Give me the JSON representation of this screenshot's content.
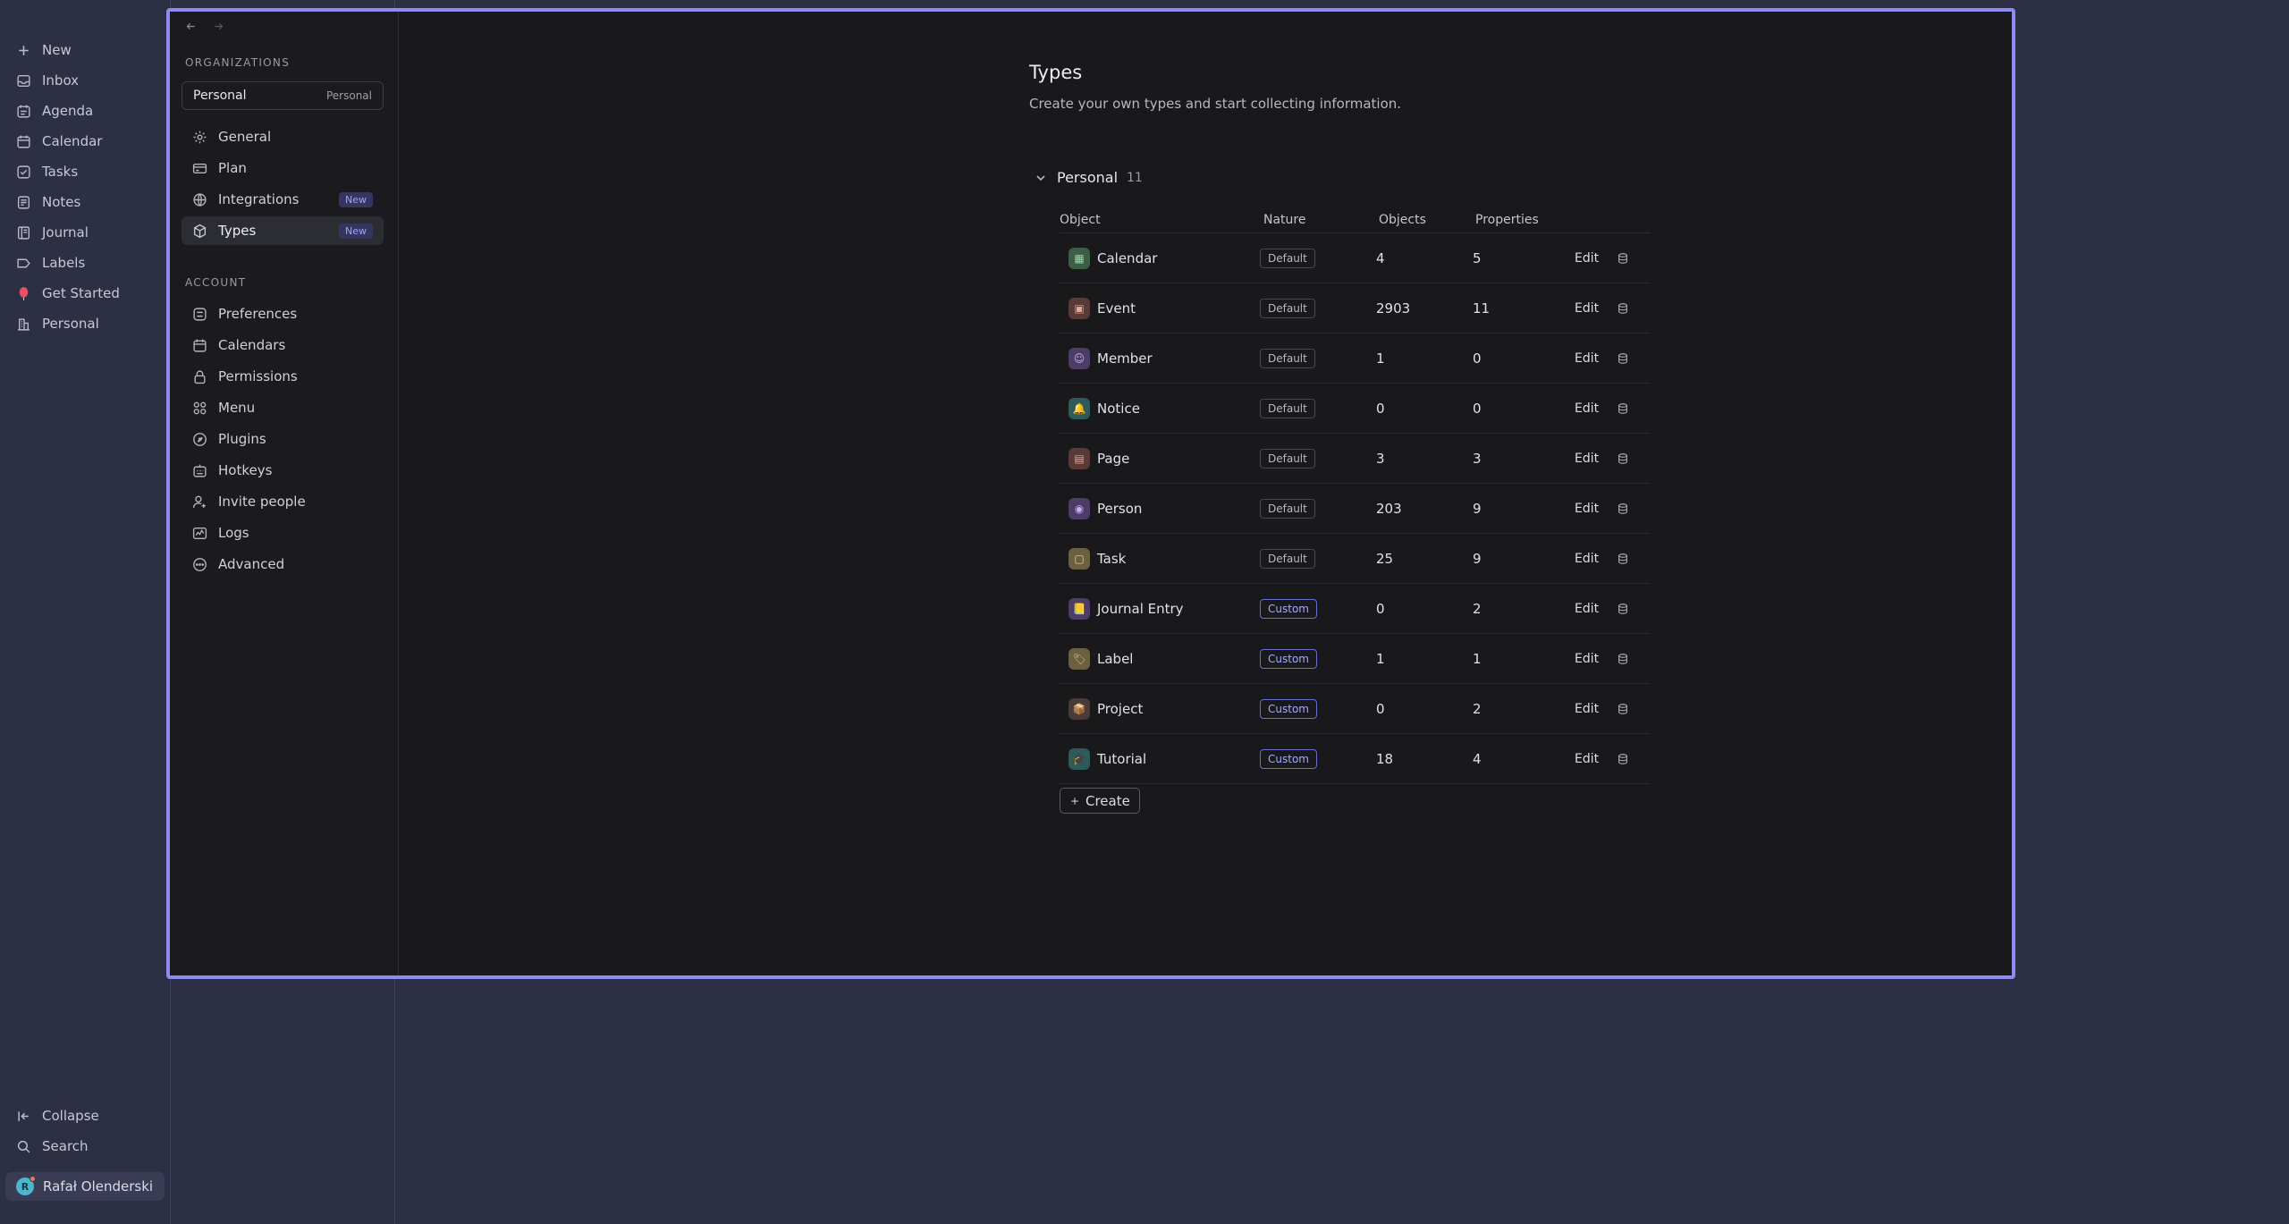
{
  "sidebar": {
    "items": [
      {
        "label": "New",
        "icon": "plus-icon"
      },
      {
        "label": "Inbox",
        "icon": "inbox-icon"
      },
      {
        "label": "Agenda",
        "icon": "agenda-icon"
      },
      {
        "label": "Calendar",
        "icon": "calendar-icon"
      },
      {
        "label": "Tasks",
        "icon": "check-square-icon"
      },
      {
        "label": "Notes",
        "icon": "notes-icon"
      },
      {
        "label": "Journal",
        "icon": "journal-icon"
      },
      {
        "label": "Labels",
        "icon": "tag-icon"
      },
      {
        "label": "Get Started",
        "icon": "balloon-icon"
      },
      {
        "label": "Personal",
        "icon": "building-icon"
      }
    ],
    "bottom": {
      "collapse_label": "Collapse",
      "search_label": "Search",
      "user_name": "Rafał Olenderski",
      "user_initial": "R"
    }
  },
  "settings": {
    "organizations_title": "ORGANIZATIONS",
    "org_name": "Personal",
    "org_tag": "Personal",
    "org_items": [
      {
        "label": "General",
        "icon": "gear-icon",
        "badge": ""
      },
      {
        "label": "Plan",
        "icon": "card-icon",
        "badge": ""
      },
      {
        "label": "Integrations",
        "icon": "globe-icon",
        "badge": "New"
      },
      {
        "label": "Types",
        "icon": "cube-icon",
        "badge": "New"
      }
    ],
    "account_title": "ACCOUNT",
    "account_items": [
      {
        "label": "Preferences",
        "icon": "preferences-icon"
      },
      {
        "label": "Calendars",
        "icon": "calendar-icon"
      },
      {
        "label": "Permissions",
        "icon": "lock-icon"
      },
      {
        "label": "Menu",
        "icon": "grid-icon"
      },
      {
        "label": "Plugins",
        "icon": "plugin-icon"
      },
      {
        "label": "Hotkeys",
        "icon": "keyboard-icon"
      },
      {
        "label": "Invite people",
        "icon": "user-plus-icon"
      },
      {
        "label": "Logs",
        "icon": "logs-icon"
      },
      {
        "label": "Advanced",
        "icon": "more-icon"
      }
    ]
  },
  "main": {
    "title": "Types",
    "subtitle": "Create your own types and start collecting information.",
    "group": {
      "name": "Personal",
      "count": "11"
    },
    "columns": {
      "object": "Object",
      "nature": "Nature",
      "objects": "Objects",
      "properties": "Properties"
    },
    "edit_label": "Edit",
    "create_label": "Create",
    "rows": [
      {
        "name": "Calendar",
        "nature": "Default",
        "objects": "4",
        "properties": "5",
        "icon_bg": "#3d5e45",
        "icon_fg": "#9cd8a6",
        "glyph": "▦"
      },
      {
        "name": "Event",
        "nature": "Default",
        "objects": "2903",
        "properties": "11",
        "icon_bg": "#5a3a36",
        "icon_fg": "#e0a79b",
        "glyph": "▣"
      },
      {
        "name": "Member",
        "nature": "Default",
        "objects": "1",
        "properties": "0",
        "icon_bg": "#4d3d66",
        "icon_fg": "#c4b0ee",
        "glyph": "☺"
      },
      {
        "name": "Notice",
        "nature": "Default",
        "objects": "0",
        "properties": "0",
        "icon_bg": "#2f5a5c",
        "icon_fg": "#f2c94c",
        "glyph": "🔔"
      },
      {
        "name": "Page",
        "nature": "Default",
        "objects": "3",
        "properties": "3",
        "icon_bg": "#5a3a36",
        "icon_fg": "#e0a79b",
        "glyph": "▤"
      },
      {
        "name": "Person",
        "nature": "Default",
        "objects": "203",
        "properties": "9",
        "icon_bg": "#4d3d66",
        "icon_fg": "#c4b0ee",
        "glyph": "◉"
      },
      {
        "name": "Task",
        "nature": "Default",
        "objects": "25",
        "properties": "9",
        "icon_bg": "#6b6040",
        "icon_fg": "#e6d58e",
        "glyph": "▢"
      },
      {
        "name": "Journal Entry",
        "nature": "Custom",
        "objects": "0",
        "properties": "2",
        "icon_bg": "#4d3d66",
        "icon_fg": "#f0c040",
        "glyph": "📒"
      },
      {
        "name": "Label",
        "nature": "Custom",
        "objects": "1",
        "properties": "1",
        "icon_bg": "#6b6040",
        "icon_fg": "#e8c060",
        "glyph": "🏷"
      },
      {
        "name": "Project",
        "nature": "Custom",
        "objects": "0",
        "properties": "2",
        "icon_bg": "#4a3a38",
        "icon_fg": "#d9a46a",
        "glyph": "📦"
      },
      {
        "name": "Tutorial",
        "nature": "Custom",
        "objects": "18",
        "properties": "4",
        "icon_bg": "#2f5a5c",
        "icon_fg": "#8fd6d6",
        "glyph": "🎓"
      }
    ]
  },
  "colors": {
    "accent": "#8a8cf0",
    "background": "#2d2f45",
    "modal_bg": "#19191c"
  }
}
